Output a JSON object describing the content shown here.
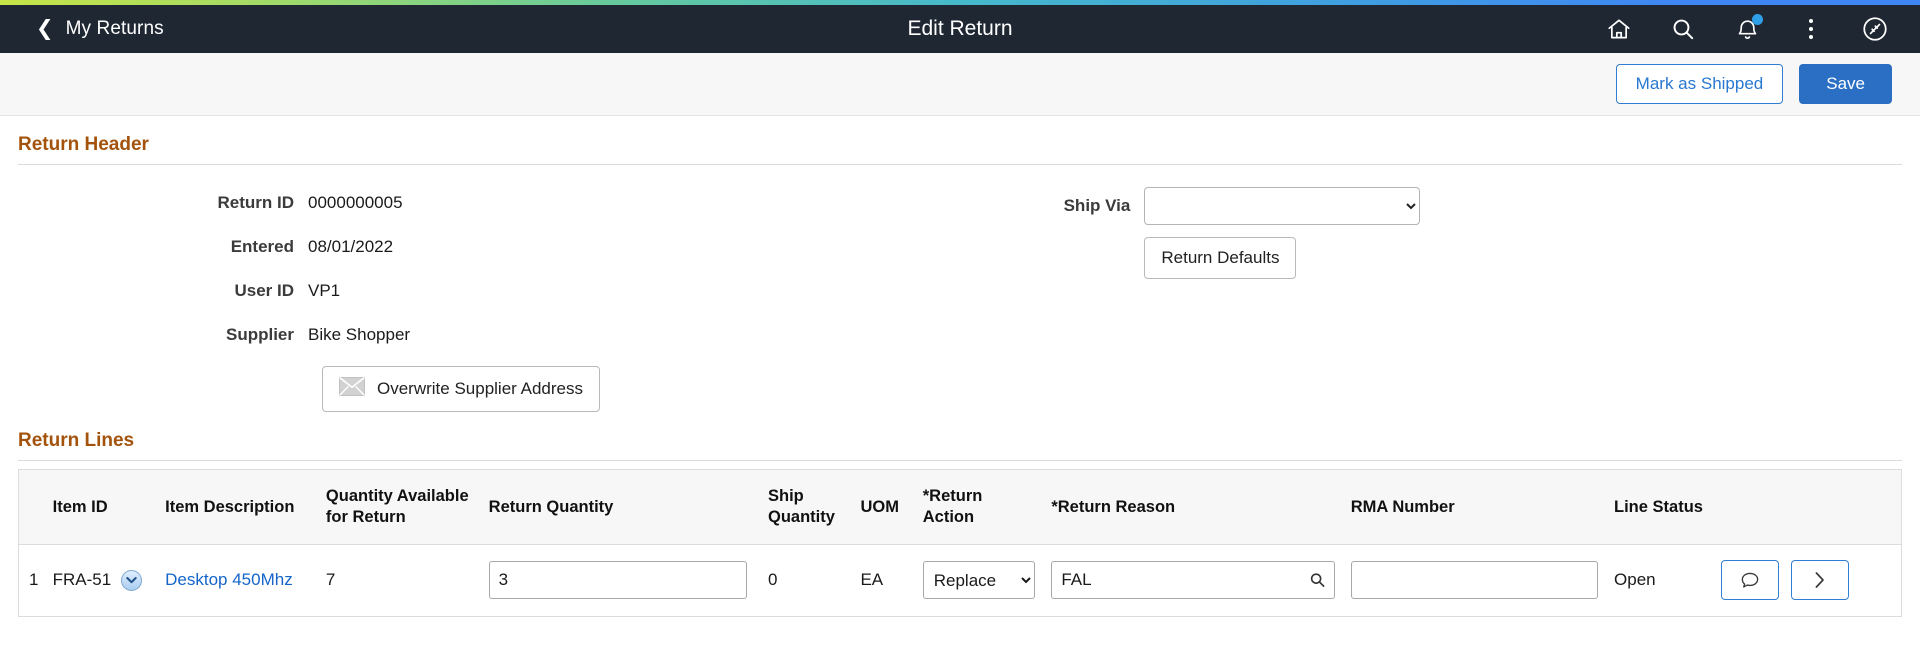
{
  "navbar": {
    "back_label": "My Returns",
    "title": "Edit Return",
    "icons": [
      {
        "name": "home-icon"
      },
      {
        "name": "search-icon"
      },
      {
        "name": "notifications-bell-icon",
        "badge": true
      },
      {
        "name": "actions-kebab-icon"
      },
      {
        "name": "nav-bar-compass-icon"
      }
    ]
  },
  "toolbar": {
    "mark_shipped_label": "Mark as Shipped",
    "save_label": "Save"
  },
  "return_header": {
    "section_title": "Return Header",
    "fields": [
      {
        "label": "Return ID",
        "value": "0000000005"
      },
      {
        "label": "Entered",
        "value": "08/01/2022"
      },
      {
        "label": "User ID",
        "value": "VP1"
      },
      {
        "label": "Supplier",
        "value": "Bike Shopper"
      }
    ],
    "overwrite_address_label": "Overwrite Supplier Address",
    "ship_via_label": "Ship Via",
    "ship_via_value": "",
    "ship_via_options": [
      ""
    ],
    "return_defaults_label": "Return Defaults"
  },
  "return_lines": {
    "section_title": "Return Lines",
    "columns": [
      "",
      "Item ID",
      "Item Description",
      "Quantity Available for Return",
      "Return Quantity",
      "Ship Quantity",
      "UOM",
      "*Return Action",
      "*Return Reason",
      "RMA Number",
      "Line Status",
      ""
    ],
    "rows": [
      {
        "seq": "1",
        "item_id": "FRA-51",
        "item_description": "Desktop 450Mhz",
        "qty_available": "7",
        "return_quantity": "3",
        "ship_quantity": "0",
        "uom": "EA",
        "return_action": "Replace",
        "return_action_options": [
          "Replace"
        ],
        "return_reason": "FAL",
        "rma_number": "",
        "line_status": "Open"
      }
    ]
  },
  "colors": {
    "navbar_bg": "#1f2733",
    "section_heading": "#a4530d",
    "primary_button": "#2a6fc4",
    "link": "#1565c9",
    "badge": "#2f9fe8"
  }
}
